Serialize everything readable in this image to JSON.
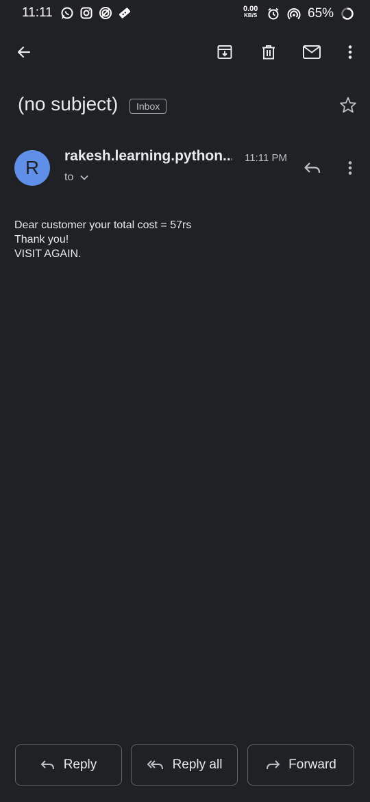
{
  "status_bar": {
    "time": "11:11",
    "net_speed_value": "0.00",
    "net_speed_unit": "KB/S",
    "battery": "65%",
    "left_icons": [
      "whatsapp-icon",
      "instagram-icon",
      "target-app-icon",
      "ticket-icon"
    ]
  },
  "toolbar": {
    "icons": [
      "back-arrow-icon",
      "archive-icon",
      "delete-icon",
      "mark-unread-icon",
      "more-vert-icon"
    ]
  },
  "message": {
    "subject": "(no subject)",
    "label": "Inbox",
    "avatar_letter": "R",
    "sender": "rakesh.learning.python...",
    "time": "11:11 PM",
    "recipient_prefix": "to",
    "body_lines": [
      "Dear customer your total cost = 57rs",
      "Thank you!",
      "VISIT AGAIN."
    ]
  },
  "actions": {
    "reply": "Reply",
    "reply_all": "Reply all",
    "forward": "Forward"
  },
  "colors": {
    "background": "#202124",
    "avatar": "#5f8fe8",
    "text": "#e8eaed",
    "muted": "#bdc1c6",
    "border": "#5f6368"
  }
}
